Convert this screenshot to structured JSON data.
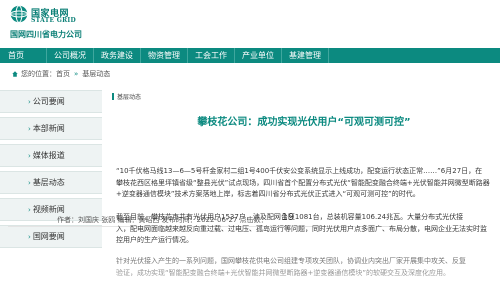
{
  "brand": {
    "name_cn": "国家电网",
    "name_en": "STATE GRID",
    "company": "国网四川省电力公司",
    "colors": {
      "primary": "#0c8a80",
      "sidebar_bg": "#eef3f3"
    },
    "logo_icon": "state-grid-logo"
  },
  "nav": {
    "items": [
      "首页",
      "公司概况",
      "政务建设",
      "物资管理",
      "工会工作",
      "产业单位",
      "基建管理"
    ]
  },
  "breadcrumb": {
    "prefix": "您的位置：",
    "home": "首页",
    "section": "基层动态",
    "separator": "»"
  },
  "sidebar": {
    "items": [
      "公司要闻",
      "本部新闻",
      "媒体报道",
      "基层动态",
      "视频新闻",
      "国网要闻"
    ]
  },
  "article": {
    "section_tag": "基层动态",
    "title": "攀枝花公司：成功实现光伏用户“可观可测可控”",
    "meta": "作者：刘国庆 张鸥    编辑：黄昭西    发布时间：2022-06-27    点击数：",
    "page_num": "19",
    "paragraphs": [
      [
        "“10千伏格马线13—6—5号杆金家村二组1号400千伏安公变系统显示上线成功，配变运行状态正常……”6月27日，在",
        "攀枝花西区格里坪镇省级“整县光伏”试点现场，四川省首个配置分布式光伏“智能配变融合终端+光伏智能并网微型断路器",
        "+逆变器通信模块”技术方案落地上岸，标志着四川省分布式光伏正式进入“可观可测可控”的时代。"
      ],
      [
        "截至目前，攀枝花市共有光伏用户1537户，涉及配网台区1081台，总装机容量106.24兆瓦。大量分布式光伏接",
        "入，配电网面临越来越反向重过载、过电压、孤岛运行等问题，同时光伏用户点多面广、布局分散，电网企业无法实时监",
        "控用户的生产运行情况。"
      ],
      [
        "针对光伏接入产生的一系列问题，国网攀枝花供电公司组建专项攻关团队，协调业内突出厂家开展集中攻关、反复",
        "验证，成功实现“智能配变融合终端+光伏智能并网微型断路器+逆变器通信模块”的软硬交互及深度化应用。"
      ]
    ]
  }
}
